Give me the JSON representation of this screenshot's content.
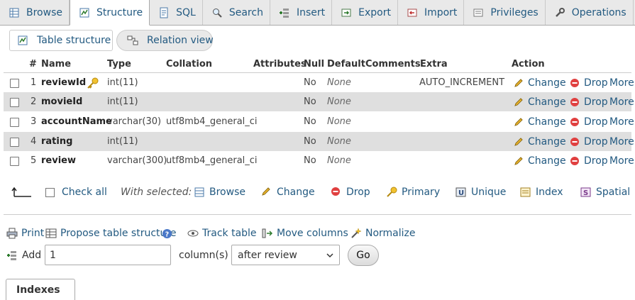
{
  "tabs": [
    {
      "label": "Browse",
      "icon": "browse-icon",
      "active": false
    },
    {
      "label": "Structure",
      "icon": "structure-icon",
      "active": true
    },
    {
      "label": "SQL",
      "icon": "sql-icon",
      "active": false
    },
    {
      "label": "Search",
      "icon": "search-icon",
      "active": false
    },
    {
      "label": "Insert",
      "icon": "insert-icon",
      "active": false
    },
    {
      "label": "Export",
      "icon": "export-icon",
      "active": false
    },
    {
      "label": "Import",
      "icon": "import-icon",
      "active": false
    },
    {
      "label": "Privileges",
      "icon": "privileges-icon",
      "active": false
    },
    {
      "label": "Operations",
      "icon": "operations-icon",
      "active": false
    }
  ],
  "subtabs": {
    "table_structure": "Table structure",
    "relation_view": "Relation view"
  },
  "columns": {
    "num": "#",
    "name": "Name",
    "type": "Type",
    "collation": "Collation",
    "attributes": "Attributes",
    "null": "Null",
    "default": "Default",
    "comments": "Comments",
    "extra": "Extra",
    "action": "Action"
  },
  "rows": [
    {
      "num": "1",
      "name": "reviewId",
      "type": "int(11)",
      "collation": "",
      "null": "No",
      "default": "None",
      "extra": "AUTO_INCREMENT",
      "primary_key": true
    },
    {
      "num": "2",
      "name": "movieId",
      "type": "int(11)",
      "collation": "",
      "null": "No",
      "default": "None",
      "extra": ""
    },
    {
      "num": "3",
      "name": "accountName",
      "type": "varchar(30)",
      "collation": "utf8mb4_general_ci",
      "null": "No",
      "default": "None",
      "extra": ""
    },
    {
      "num": "4",
      "name": "rating",
      "type": "int(11)",
      "collation": "",
      "null": "No",
      "default": "None",
      "extra": ""
    },
    {
      "num": "5",
      "name": "review",
      "type": "varchar(300)",
      "collation": "utf8mb4_general_ci",
      "null": "No",
      "default": "None",
      "extra": ""
    }
  ],
  "row_actions": {
    "change": "Change",
    "drop": "Drop",
    "more": "More"
  },
  "bulk": {
    "check_all": "Check all",
    "with_selected": "With selected:",
    "browse": "Browse",
    "change": "Change",
    "drop": "Drop",
    "primary": "Primary",
    "unique": "Unique",
    "index": "Index",
    "spatial": "Spatial"
  },
  "tools": {
    "print": "Print",
    "propose": "Propose table structure",
    "track": "Track table",
    "move": "Move columns",
    "normalize": "Normalize"
  },
  "add": {
    "label": "Add",
    "count": "1",
    "columns_label": "column(s)",
    "position": "after review",
    "go": "Go"
  },
  "indexes_label": "Indexes",
  "colors": {
    "link": "#235a81",
    "row_alt": "#dfdfdf",
    "tab_bar": "#e9e9e9"
  }
}
